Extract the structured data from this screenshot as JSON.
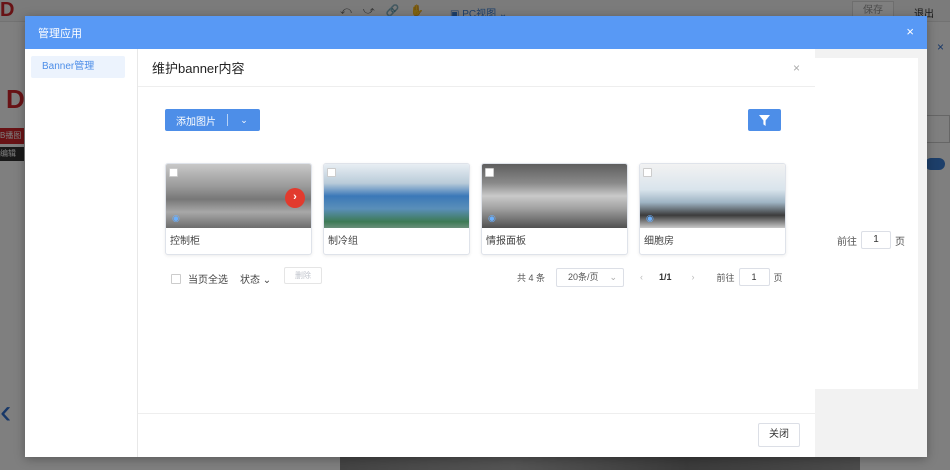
{
  "background": {
    "logo": "D",
    "tools": "⤺ ⤻ 🔗 ✋",
    "view_mode": "PC视图",
    "save_label": "保存",
    "exit_label": "退出",
    "tag_red": "B播图",
    "tag_dark": "编辑"
  },
  "outer_dialog": {
    "title": "管理应用",
    "close": "×",
    "sidebar": {
      "items": [
        {
          "label": "Banner管理"
        }
      ]
    },
    "right_pager": {
      "goto_label": "前往",
      "page": "1",
      "page_unit": "页"
    }
  },
  "inner_dialog": {
    "title": "维护banner内容",
    "close": "×",
    "toolbar": {
      "add_label": "添加图片",
      "filter_icon": "filter-icon"
    },
    "cards": [
      {
        "name": "控制柜"
      },
      {
        "name": "制冷组"
      },
      {
        "name": "情报面板"
      },
      {
        "name": "细胞房"
      }
    ],
    "bottom": {
      "select_all": "当页全选",
      "status": "状态",
      "delete": "删除",
      "total": "共 4 条",
      "page_size": "20条/页",
      "current": "1/1",
      "goto_label": "前往",
      "goto_page": "1",
      "page_unit": "页"
    },
    "footer": {
      "close_label": "关闭"
    }
  },
  "colors": {
    "header": "#5899f5",
    "primary": "#4d8ee8",
    "danger": "#e23b2e"
  }
}
